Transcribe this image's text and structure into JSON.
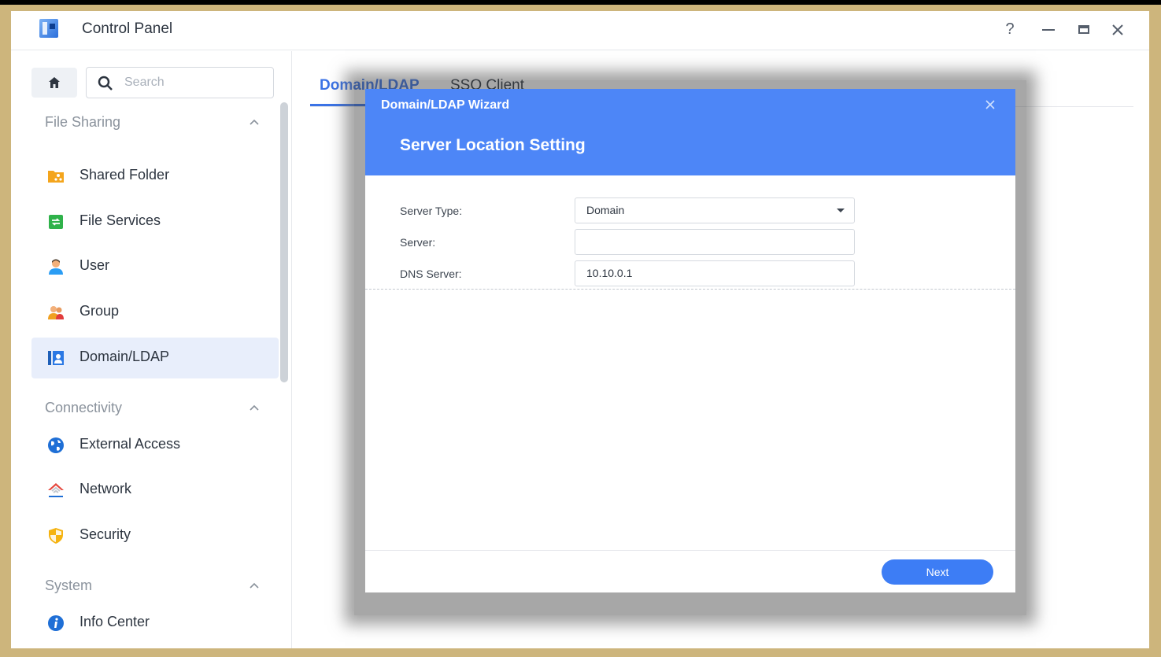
{
  "window": {
    "title": "Control Panel",
    "controls": {
      "help": "?"
    }
  },
  "sidebar": {
    "search_placeholder": "Search",
    "sections": [
      {
        "title": "File Sharing",
        "items": [
          {
            "label": "Shared Folder",
            "icon": "shared-folder-icon"
          },
          {
            "label": "File Services",
            "icon": "file-services-icon"
          },
          {
            "label": "User",
            "icon": "user-icon"
          },
          {
            "label": "Group",
            "icon": "group-icon"
          },
          {
            "label": "Domain/LDAP",
            "icon": "domain-ldap-icon",
            "active": true
          }
        ]
      },
      {
        "title": "Connectivity",
        "items": [
          {
            "label": "External Access",
            "icon": "globe-icon"
          },
          {
            "label": "Network",
            "icon": "network-house-icon"
          },
          {
            "label": "Security",
            "icon": "shield-icon"
          }
        ]
      },
      {
        "title": "System",
        "items": [
          {
            "label": "Info Center",
            "icon": "info-icon"
          }
        ]
      }
    ]
  },
  "main": {
    "tabs": [
      {
        "label": "Domain/LDAP",
        "active": true
      },
      {
        "label": "SSO Client"
      }
    ]
  },
  "wizard": {
    "title": "Domain/LDAP Wizard",
    "step_title": "Server Location Setting",
    "fields": {
      "server_type": {
        "label": "Server Type:",
        "value": "Domain"
      },
      "server": {
        "label": "Server:",
        "value": ""
      },
      "dns_server": {
        "label": "DNS Server:",
        "value": "10.10.0.1"
      }
    },
    "next_label": "Next"
  },
  "colors": {
    "accent": "#3b73e6",
    "header": "#4d86f7",
    "frame": "#cdb57c"
  }
}
